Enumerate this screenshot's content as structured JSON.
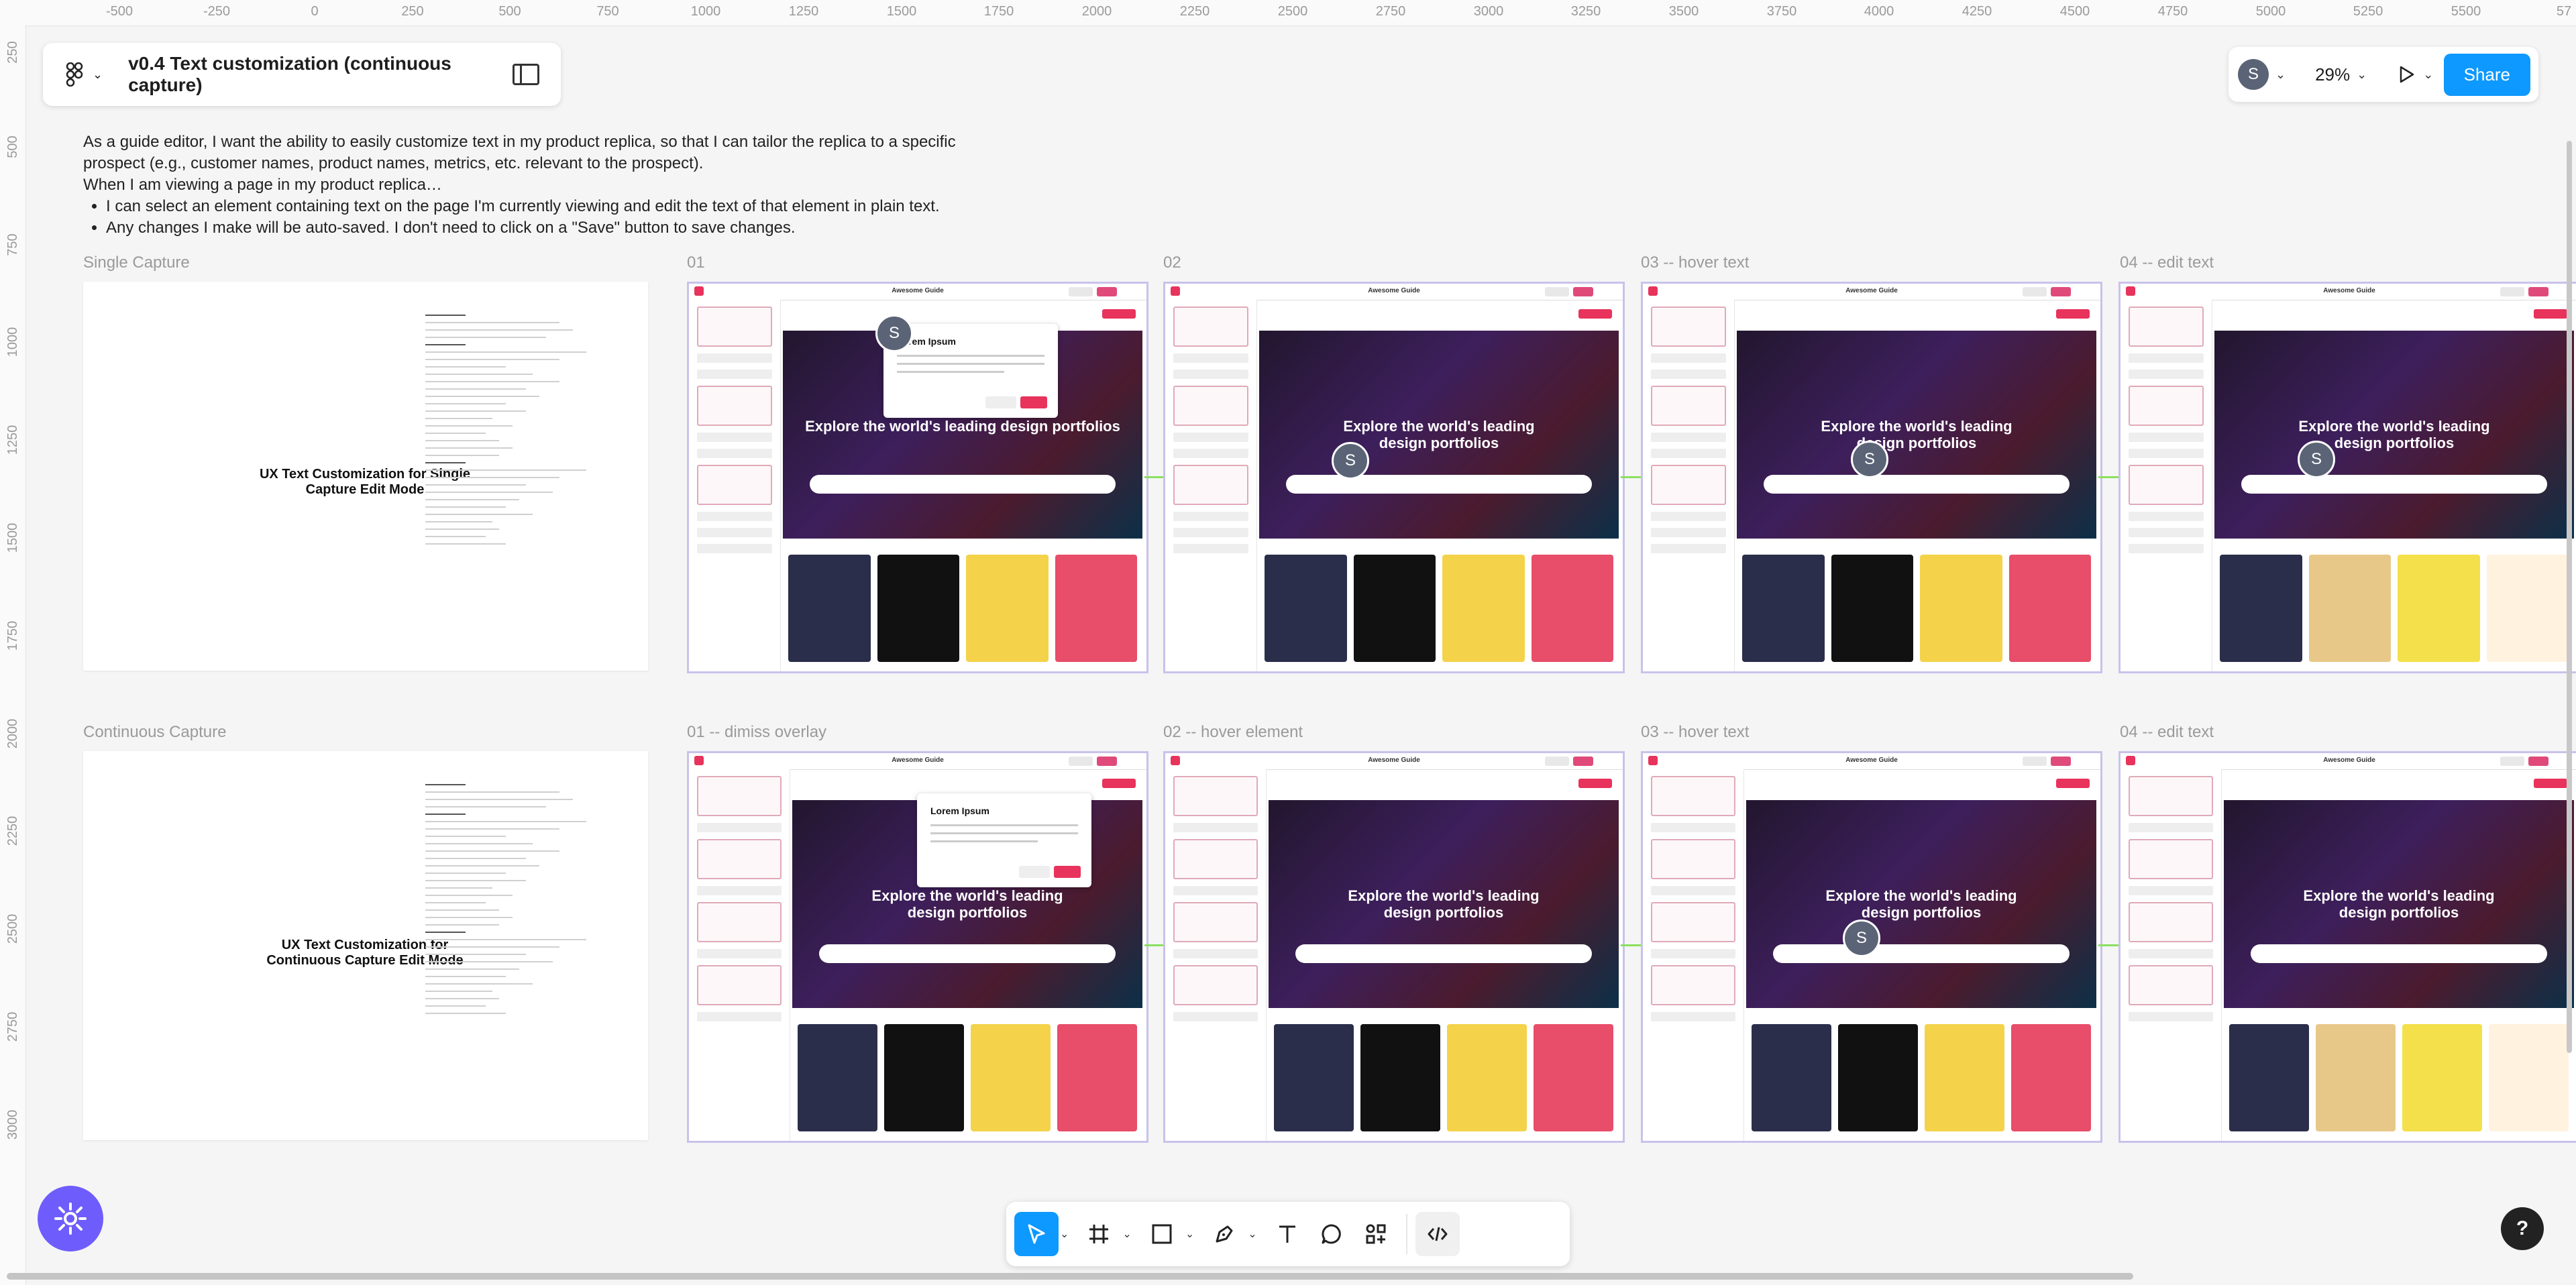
{
  "app": {
    "file_title": "v0.4 Text customization (continuous capture)",
    "zoom": "29%",
    "share_label": "Share",
    "avatar_letter": "S"
  },
  "rulers": {
    "top": [
      "-500",
      "-250",
      "0",
      "250",
      "500",
      "750",
      "1000",
      "1250",
      "1500",
      "1750",
      "2000",
      "2250",
      "2500",
      "2750",
      "3000",
      "3250",
      "3500",
      "3750",
      "4000",
      "4250",
      "4500",
      "4750",
      "5000",
      "5250",
      "5500",
      "57"
    ],
    "left": [
      "250",
      "500",
      "750",
      "1000",
      "1250",
      "1500",
      "1750",
      "2000",
      "2250",
      "2500",
      "2750",
      "3000"
    ]
  },
  "description": {
    "line1": "As a guide editor, I want the ability to easily customize text in my product replica, so that I can tailor the replica to a specific",
    "line2": "prospect (e.g., customer names, product names, metrics, etc. relevant to the prospect).",
    "line3": "When I am viewing a page in my product replica…",
    "bullets": [
      "I can select an element containing text on the page I'm currently viewing and edit the text of that element in plain text.",
      "Any changes I make will be auto-saved. I don't need to click on a \"Save\" button to save changes."
    ]
  },
  "sections": {
    "single": {
      "label": "Single Capture",
      "doc_title": "UX Text Customization for Single Capture Edit Mode",
      "frames": [
        "01",
        "02",
        "03 -- hover text",
        "04 -- edit text"
      ]
    },
    "continuous": {
      "label": "Continuous Capture",
      "doc_title": "UX Text Customization for Continuous Capture Edit Mode",
      "frames": [
        "01 -- dimiss overlay",
        "02 -- hover element",
        "03 -- hover text",
        "04 -- edit text"
      ]
    }
  },
  "frame_content": {
    "app_title": "Awesome Guide",
    "hero_text": "Explore the world's leading design portfolios",
    "popup_title": "Lorem Ipsum"
  },
  "colors": {
    "accent": "#0d99ff",
    "frame_border": "#c9c2eb",
    "connector": "#8be05f",
    "plugin": "#6e5dfc"
  },
  "icons": [
    "figma-menu-icon",
    "panel-toggle-icon",
    "play-icon",
    "move-tool-icon",
    "frame-tool-icon",
    "rectangle-tool-icon",
    "pen-tool-icon",
    "text-tool-icon",
    "comment-tool-icon",
    "components-icon",
    "dev-mode-icon",
    "plugin-icon",
    "help-icon"
  ],
  "help_label": "?"
}
